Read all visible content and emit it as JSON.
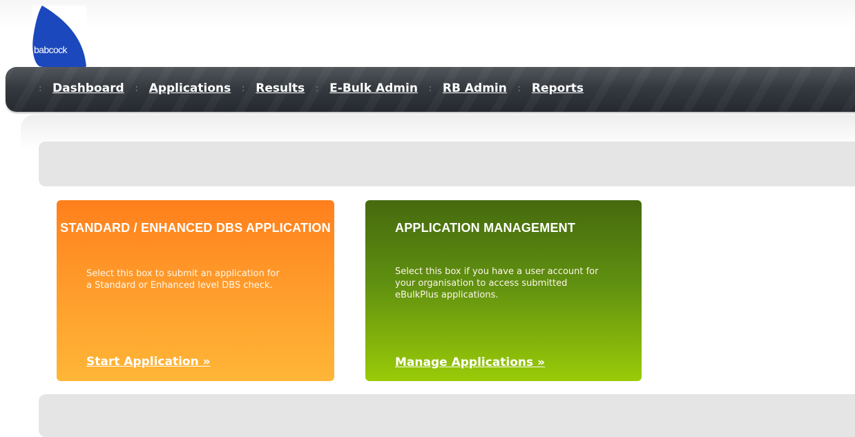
{
  "logo": {
    "text": "babcock",
    "color": "#1c48bd"
  },
  "nav": {
    "items": [
      {
        "label": "Dashboard"
      },
      {
        "label": "Applications"
      },
      {
        "label": "Results"
      },
      {
        "label": "E-Bulk Admin"
      },
      {
        "label": "RB Admin"
      },
      {
        "label": "Reports"
      }
    ],
    "separator": ":"
  },
  "cards": [
    {
      "title": "STANDARD / ENHANCED DBS APPLICATION",
      "description": "Select this box to submit an application for a Standard or Enhanced level DBS check.",
      "link": "Start Application »",
      "color": "#ff8c22"
    },
    {
      "title": "APPLICATION MANAGEMENT",
      "description": "Select this box if you have a user account for your organisation to access submitted eBulkPlus applications.",
      "link": "Manage Applications »",
      "color": "#5f8f10"
    }
  ]
}
